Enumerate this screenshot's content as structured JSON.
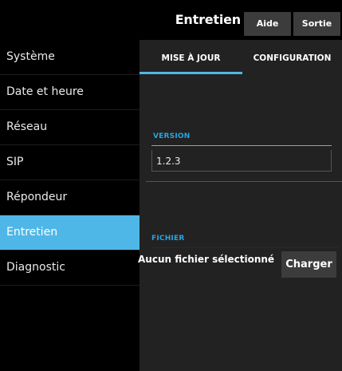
{
  "header": {
    "title": "Entretien",
    "help_label": "Aide",
    "exit_label": "Sortie"
  },
  "sidebar": {
    "items": [
      {
        "label": "Système",
        "active": false
      },
      {
        "label": "Date et heure",
        "active": false
      },
      {
        "label": "Réseau",
        "active": false
      },
      {
        "label": "SIP",
        "active": false
      },
      {
        "label": "Répondeur",
        "active": false
      },
      {
        "label": "Entretien",
        "active": true
      },
      {
        "label": "Diagnostic",
        "active": false
      }
    ]
  },
  "tabs": [
    {
      "label": "MISE À JOUR",
      "active": true
    },
    {
      "label": "CONFIGURATION",
      "active": false
    }
  ],
  "version": {
    "label": "VERSION",
    "value": "1.2.3"
  },
  "file": {
    "label": "FICHIER",
    "status": "Aucun fichier sélectionné",
    "load_label": "Charger"
  },
  "colors": {
    "accent": "#4fb7e8",
    "panel": "#222222",
    "button": "#3c3c3c"
  }
}
